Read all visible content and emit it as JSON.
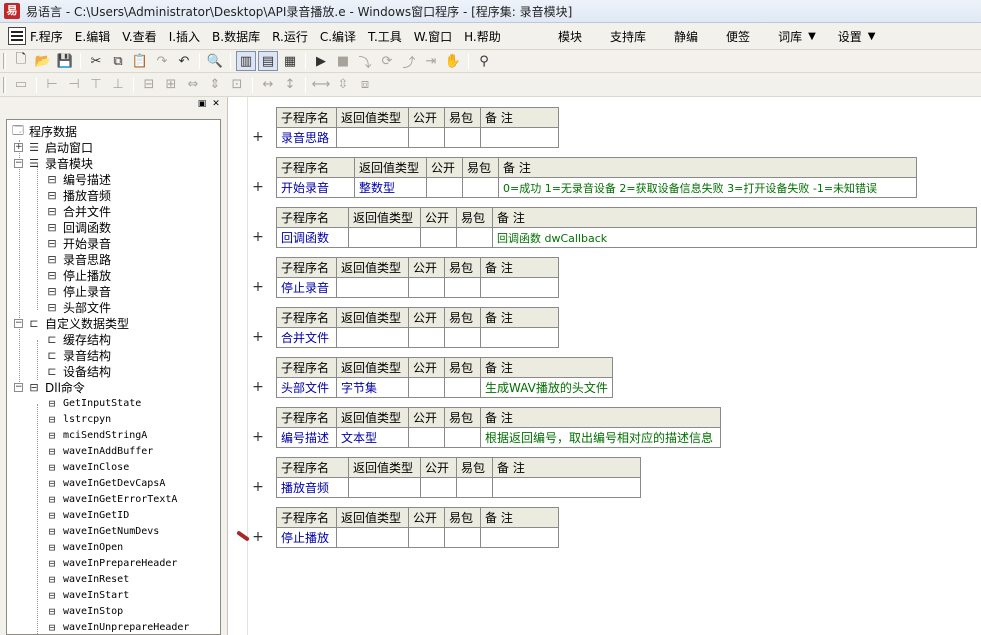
{
  "title": "易语言 - C:\\Users\\Administrator\\Desktop\\API录音播放.e - Windows窗口程序 - [程序集: 录音模块]",
  "menu": {
    "items": [
      "F.程序",
      "E.编辑",
      "V.查看",
      "I.插入",
      "B.数据库",
      "R.运行",
      "C.编译",
      "T.工具",
      "W.窗口",
      "H.帮助"
    ],
    "right_items": [
      "模块",
      "支持库",
      "静编",
      "便签",
      "词库",
      "设置"
    ]
  },
  "tree": {
    "root": "程序数据",
    "startup": "启动窗口",
    "module": "录音模块",
    "module_items": [
      "编号描述",
      "播放音频",
      "合并文件",
      "回调函数",
      "开始录音",
      "录音思路",
      "停止播放",
      "停止录音",
      "头部文件"
    ],
    "custom_types": "自定义数据类型",
    "custom_type_items": [
      "缓存结构",
      "录音结构",
      "设备结构"
    ],
    "dll": "Dll命令",
    "dll_items": [
      "GetInputState",
      "lstrcpyn",
      "mciSendStringA",
      "waveInAddBuffer",
      "waveInClose",
      "waveInGetDevCapsA",
      "waveInGetErrorTextA",
      "waveInGetID",
      "waveInGetNumDevs",
      "waveInOpen",
      "waveInPrepareHeader",
      "waveInReset",
      "waveInStart",
      "waveInStop",
      "waveInUnprepareHeader"
    ]
  },
  "headers": {
    "name": "子程序名",
    "return_type": "返回值类型",
    "public": "公开",
    "easy_pkg": "易包",
    "note": "备 注"
  },
  "subs": [
    {
      "name": "录音思路",
      "type": "",
      "note": ""
    },
    {
      "name": "开始录音",
      "type": "整数型",
      "note": "0=成功  1=无录音设备 2=获取设备信息失败  3=打开设备失败  -1=未知错误"
    },
    {
      "name": "回调函数",
      "type": "",
      "note": "回调函数 dwCallback"
    },
    {
      "name": "停止录音",
      "type": "",
      "note": ""
    },
    {
      "name": "合并文件",
      "type": "",
      "note": ""
    },
    {
      "name": "头部文件",
      "type": "字节集",
      "note": "生成WAV播放的头文件"
    },
    {
      "name": "编号描述",
      "type": "文本型",
      "note": "根据返回编号，取出编号相对应的描述信息"
    },
    {
      "name": "播放音频",
      "type": "",
      "note": ""
    },
    {
      "name": "停止播放",
      "type": "",
      "note": ""
    }
  ],
  "plus_symbol": "+"
}
